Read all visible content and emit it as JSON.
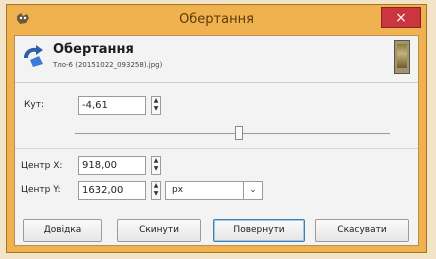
{
  "window": {
    "title": "Обертання",
    "close_glyph": "×",
    "app_icon": "gimp-icon"
  },
  "header": {
    "title": "Обертання",
    "subtitle": "Тло-6 (20151022_093258).jpg)",
    "icon": "rotate-icon",
    "thumbnail": "image-thumbnail"
  },
  "form": {
    "angle_label": "Кут:",
    "angle_value": "-4,61",
    "angle_slider_fraction": 0.52,
    "center_x_label": "Центр X:",
    "center_x_value": "918,00",
    "center_y_label": "Центр Y:",
    "center_y_value": "1632,00",
    "unit_value": "px",
    "spin_up": "▲",
    "spin_down": "▼",
    "combo_arrow": "⌄"
  },
  "buttons": {
    "help": "Довідка",
    "reset": "Скинути",
    "rotate": "Повернути",
    "cancel": "Скасувати"
  }
}
